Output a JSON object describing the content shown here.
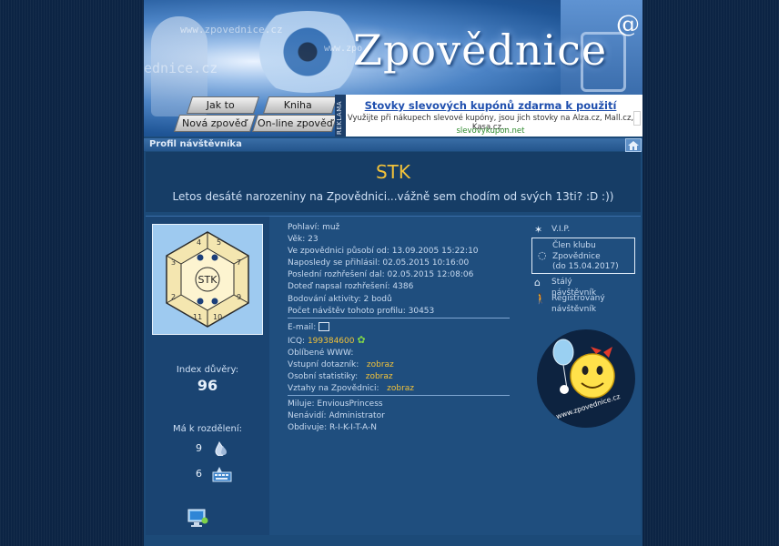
{
  "header": {
    "logo": "Zpovědnice",
    "watermark_1": "www.zpovednice.cz",
    "watermark_2": "www.zpo",
    "watermark_3": "ednice.cz",
    "nav": {
      "how_it_works": "Jak to funguje",
      "guestbook": "Kniha návštěv",
      "new_confession": "Nová zpověď",
      "online_confession": "On-line zpověď"
    },
    "ad": {
      "tag": "REKLAMA",
      "title": "Stovky slevových kupónů zdarma k použití",
      "text": "Využijte při nákupech slevové kupóny, jsou jich stovky na Alza.cz, Mall.cz, Kasa.cz...",
      "url": "slevovykupon.net"
    }
  },
  "section_title": "Profil návštěvníka",
  "profile": {
    "nick": "STK",
    "motto": "Letos desáté narozeniny na Zpovědnici...vážně sem chodím od svých 13ti? :D :))",
    "avatar_text": "STK",
    "trust_label": "Index důvěry:",
    "trust_value": "96",
    "share_label": "Má k rozdělení:",
    "share_1": "9",
    "share_2": "6",
    "details": {
      "gender_label": "Pohlaví:",
      "gender": "muž",
      "age_label": "Věk:",
      "age": "23",
      "active_since_label": "Ve zpovědnici působí od:",
      "active_since": "13.09.2005 15:22:10",
      "last_login_label": "Naposledy se přihlásil:",
      "last_login": "02.05.2015 10:16:00",
      "last_verdict_label": "Poslední rozhřešení dal:",
      "last_verdict": "02.05.2015 12:08:06",
      "verdicts_label": "Doteď napsal rozhřešení:",
      "verdicts": "4386",
      "activity_label": "Bodování aktivity:",
      "activity": "2 bodů",
      "visits_label": "Počet návštěv tohoto profilu:",
      "visits": "30453"
    },
    "contact": {
      "email_label": "E-mail:",
      "icq_label": "ICQ:",
      "icq": "199384600",
      "www_label": "Oblíbené WWW:",
      "entry_label": "Vstupní dotazník:",
      "entry_link": "zobraz",
      "stats_label": "Osobní statistiky:",
      "stats_link": "zobraz",
      "relations_label": "Vztahy na Zpovědnici:",
      "relations_link": "zobraz"
    },
    "relations": {
      "loves_label": "Miluje:",
      "loves": "EnviousPrincess",
      "hates_label": "Nenávidí:",
      "hates": "Administrator",
      "admires_label": "Obdivuje:",
      "admires": "R-I-K-I-T-A-N"
    },
    "badges": {
      "vip": "V.I.P.",
      "club_line1": "Člen klubu",
      "club_line2": "Zpovědnice",
      "club_line3": "(do 15.04.2017)",
      "regular_line1": "Stálý",
      "regular_line2": "návštěvník",
      "registered_line1": "Registrovaný",
      "registered_line2": "návštěvník"
    },
    "rank_image_url": "www.zpovednice.cz"
  },
  "colors": {
    "background": "#0c2444",
    "panel": "#1c4a78",
    "accent_yellow": "#f2c23a",
    "ad_link": "#1f4fae"
  }
}
